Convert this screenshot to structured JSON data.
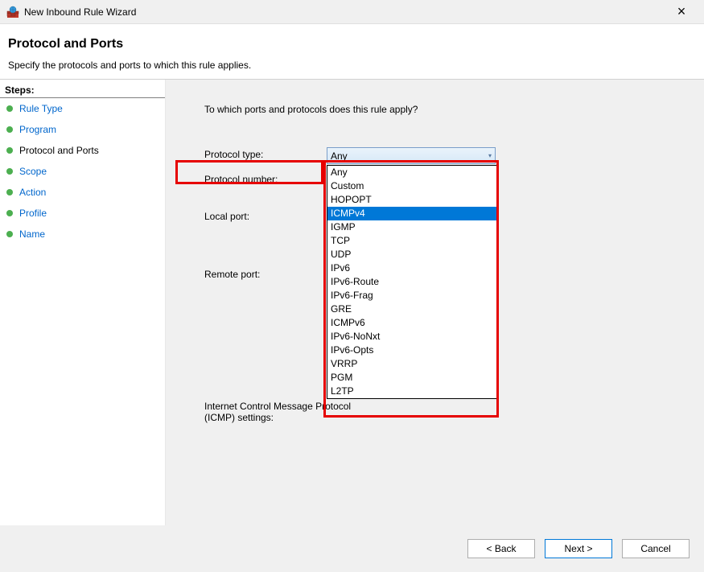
{
  "titlebar": {
    "title": "New Inbound Rule Wizard",
    "close": "×"
  },
  "header": {
    "title": "Protocol and Ports",
    "subtitle": "Specify the protocols and ports to which this rule applies."
  },
  "sidebar": {
    "heading": "Steps:",
    "items": [
      {
        "label": "Rule Type",
        "current": false
      },
      {
        "label": "Program",
        "current": false
      },
      {
        "label": "Protocol and Ports",
        "current": true
      },
      {
        "label": "Scope",
        "current": false
      },
      {
        "label": "Action",
        "current": false
      },
      {
        "label": "Profile",
        "current": false
      },
      {
        "label": "Name",
        "current": false
      }
    ]
  },
  "main": {
    "question": "To which ports and protocols does this rule apply?",
    "labels": {
      "protocol_type": "Protocol type:",
      "protocol_number": "Protocol number:",
      "local_port": "Local port:",
      "remote_port": "Remote port:",
      "icmp_line1": "Internet Control Message Protocol",
      "icmp_line2": "(ICMP) settings:"
    },
    "protocol_type": {
      "value": "Any",
      "options": [
        "Any",
        "Custom",
        "HOPOPT",
        "ICMPv4",
        "IGMP",
        "TCP",
        "UDP",
        "IPv6",
        "IPv6-Route",
        "IPv6-Frag",
        "GRE",
        "ICMPv6",
        "IPv6-NoNxt",
        "IPv6-Opts",
        "VRRP",
        "PGM",
        "L2TP"
      ],
      "highlighted": "ICMPv4"
    }
  },
  "footer": {
    "back": "< Back",
    "next": "Next >",
    "cancel": "Cancel"
  }
}
